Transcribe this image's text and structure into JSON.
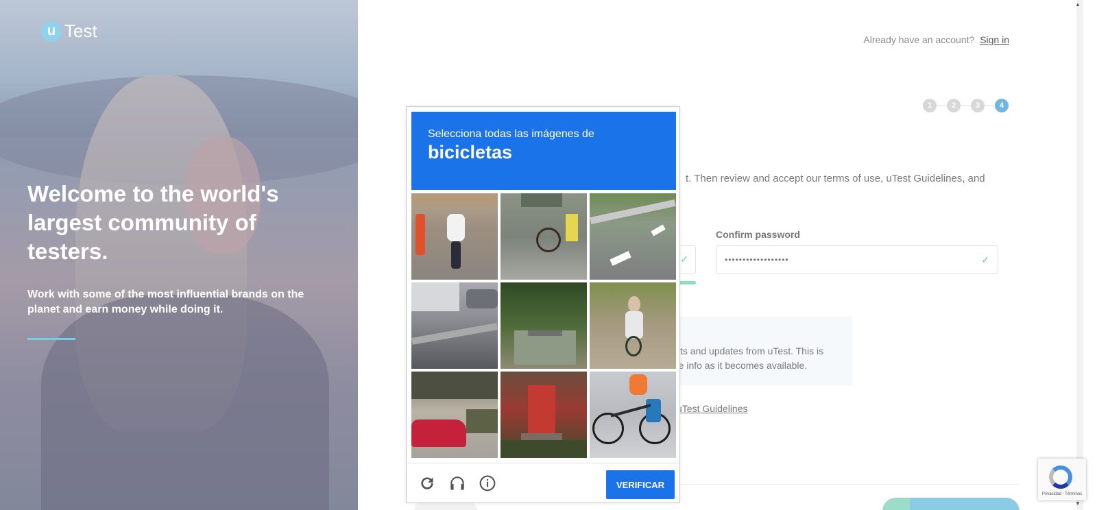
{
  "logo": {
    "mark": "u",
    "text": "Test"
  },
  "hero": {
    "title": "Welcome to the world's largest community of testers.",
    "subtitle": "Work with some of the most influential brands on the planet and earn money while doing it."
  },
  "header": {
    "account_prompt": "Already have an account?",
    "signin_link": "Sign in"
  },
  "steps": [
    "1",
    "2",
    "3",
    "4"
  ],
  "form": {
    "intro_fragment": "t. Then review and accept our terms of use, uTest Guidelines, and",
    "confirm_label": "Confirm password",
    "confirm_value": "••••••••••••••••••",
    "notice_line1": "cts and updates from uTest. This is",
    "notice_line2": "re info as it becomes available.",
    "guidelines_link": "uTest Guidelines"
  },
  "captcha": {
    "prompt": "Selecciona todas las imágenes de",
    "word": "bicicletas",
    "verify_label": "VERIFICAR",
    "tiles": [
      "tile-1",
      "tile-2",
      "tile-3",
      "tile-4",
      "tile-5",
      "tile-6",
      "tile-7",
      "tile-8",
      "tile-9"
    ]
  },
  "recaptcha": {
    "footer_text": "Privacidad - Términos"
  },
  "colors": {
    "accent": "#1a73e8",
    "step_active": "#6fb7e0",
    "success": "#6ccf9c",
    "logo": "#8fd3ea"
  }
}
